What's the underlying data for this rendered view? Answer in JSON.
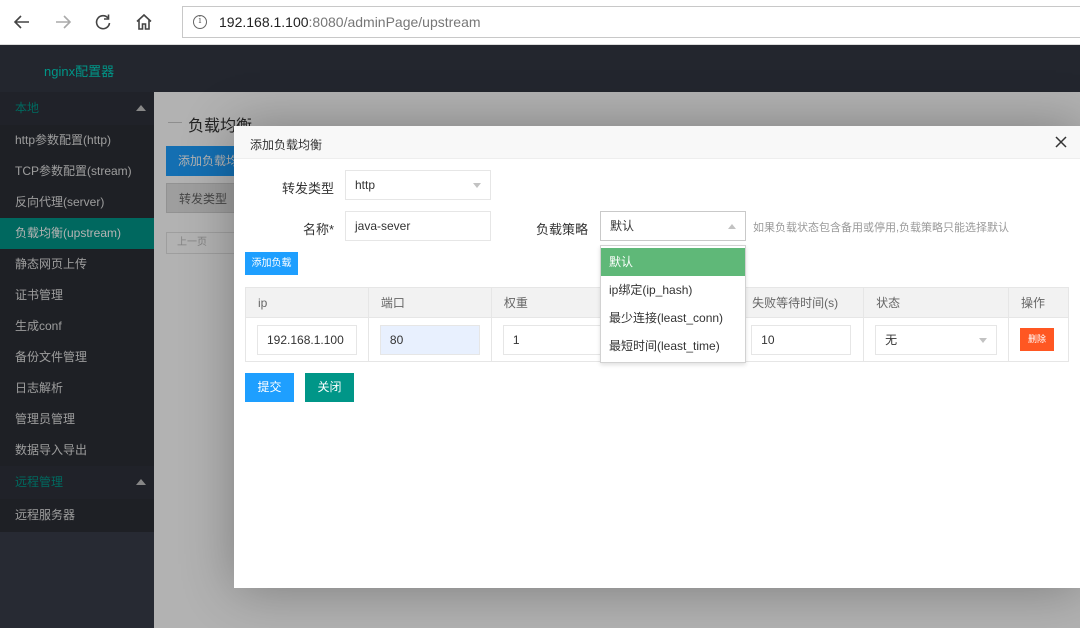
{
  "browser": {
    "url_host": "192.168.1.100",
    "url_rest": ":8080/adminPage/upstream"
  },
  "app": {
    "logo": "nginx配置器"
  },
  "sidebar": {
    "group_local": "本地",
    "items": [
      {
        "label": "http参数配置(http)"
      },
      {
        "label": "TCP参数配置(stream)"
      },
      {
        "label": "反向代理(server)"
      },
      {
        "label": "负载均衡(upstream)"
      },
      {
        "label": "静态网页上传"
      },
      {
        "label": "证书管理"
      },
      {
        "label": "生成conf"
      },
      {
        "label": "备份文件管理"
      },
      {
        "label": "日志解析"
      },
      {
        "label": "管理员管理"
      },
      {
        "label": "数据导入导出"
      }
    ],
    "group_remote": "远程管理",
    "remote_items": [
      {
        "label": "远程服务器"
      }
    ]
  },
  "main": {
    "title": "负载均衡",
    "add_button": "添加负载均",
    "forward_type_button": "转发类型",
    "pager_prev": "上一页"
  },
  "modal": {
    "title": "添加负载均衡",
    "forward_type_label": "转发类型",
    "forward_type_value": "http",
    "name_label": "名称*",
    "name_value": "java-sever",
    "strategy_label": "负载策略",
    "strategy_value": "默认",
    "hint": "如果负载状态包含备用或停用,负载策略只能选择默认",
    "add_load_button": "添加负载",
    "table": {
      "headers": [
        "ip",
        "端口",
        "权重",
        "",
        "失败等待时间(s)",
        "状态",
        "操作"
      ],
      "row": {
        "ip": "192.168.1.100",
        "port": "80",
        "weight": "1",
        "fail_timeout": "10",
        "status": "无",
        "delete": "删除"
      }
    },
    "submit_button": "提交",
    "close_button": "关闭",
    "strategy_options": [
      {
        "label": "默认"
      },
      {
        "label": "ip绑定(ip_hash)"
      },
      {
        "label": "最少连接(least_conn)"
      },
      {
        "label": "最短时间(least_time)"
      }
    ]
  },
  "colors": {
    "accent": "#009688",
    "primary": "#1e9fff",
    "danger": "#ff5722",
    "selected": "#5fb878",
    "sidebar_bg": "#393d49"
  }
}
